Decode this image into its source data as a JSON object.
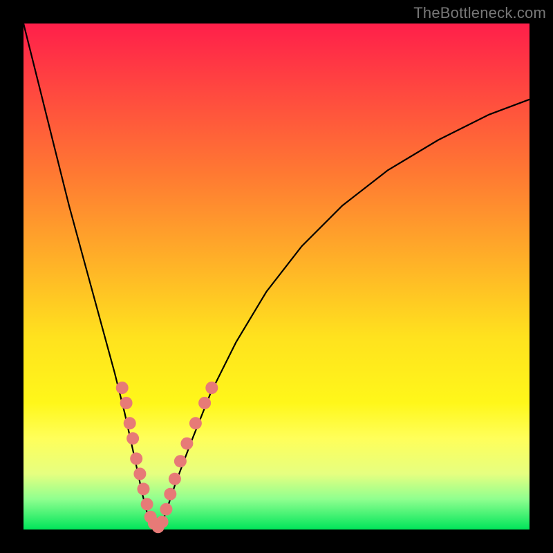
{
  "watermark": "TheBottleneck.com",
  "colors": {
    "frame": "#000000",
    "gradient_top": "#ff1f4a",
    "gradient_bottom": "#00e55a",
    "curve": "#000000",
    "dots": "#e77a77"
  },
  "chart_data": {
    "type": "line",
    "title": "",
    "xlabel": "",
    "ylabel": "",
    "xlim": [
      0,
      100
    ],
    "ylim": [
      0,
      100
    ],
    "series": [
      {
        "name": "bottleneck-curve",
        "x": [
          0,
          3,
          6,
          9,
          12,
          15,
          18,
          20,
          22,
          23.5,
          25,
          26.3,
          27,
          28,
          30,
          33,
          37,
          42,
          48,
          55,
          63,
          72,
          82,
          92,
          100
        ],
        "y": [
          100,
          88,
          76,
          64,
          53,
          42,
          31,
          23,
          14,
          7,
          1,
          0,
          0.5,
          3,
          9,
          17,
          27,
          37,
          47,
          56,
          64,
          71,
          77,
          82,
          85
        ]
      }
    ],
    "scatter_overlay": {
      "name": "sample-points",
      "points": [
        {
          "x": 19.5,
          "y": 28
        },
        {
          "x": 20.3,
          "y": 25
        },
        {
          "x": 21.0,
          "y": 21
        },
        {
          "x": 21.6,
          "y": 18
        },
        {
          "x": 22.3,
          "y": 14
        },
        {
          "x": 23.0,
          "y": 11
        },
        {
          "x": 23.7,
          "y": 8
        },
        {
          "x": 24.4,
          "y": 5
        },
        {
          "x": 25.1,
          "y": 2.5
        },
        {
          "x": 25.8,
          "y": 1.2
        },
        {
          "x": 26.6,
          "y": 0.5
        },
        {
          "x": 27.4,
          "y": 1.5
        },
        {
          "x": 28.2,
          "y": 4
        },
        {
          "x": 29.0,
          "y": 7
        },
        {
          "x": 29.9,
          "y": 10
        },
        {
          "x": 31.0,
          "y": 13.5
        },
        {
          "x": 32.3,
          "y": 17
        },
        {
          "x": 34.0,
          "y": 21
        },
        {
          "x": 35.8,
          "y": 25
        },
        {
          "x": 37.2,
          "y": 28
        }
      ]
    }
  }
}
